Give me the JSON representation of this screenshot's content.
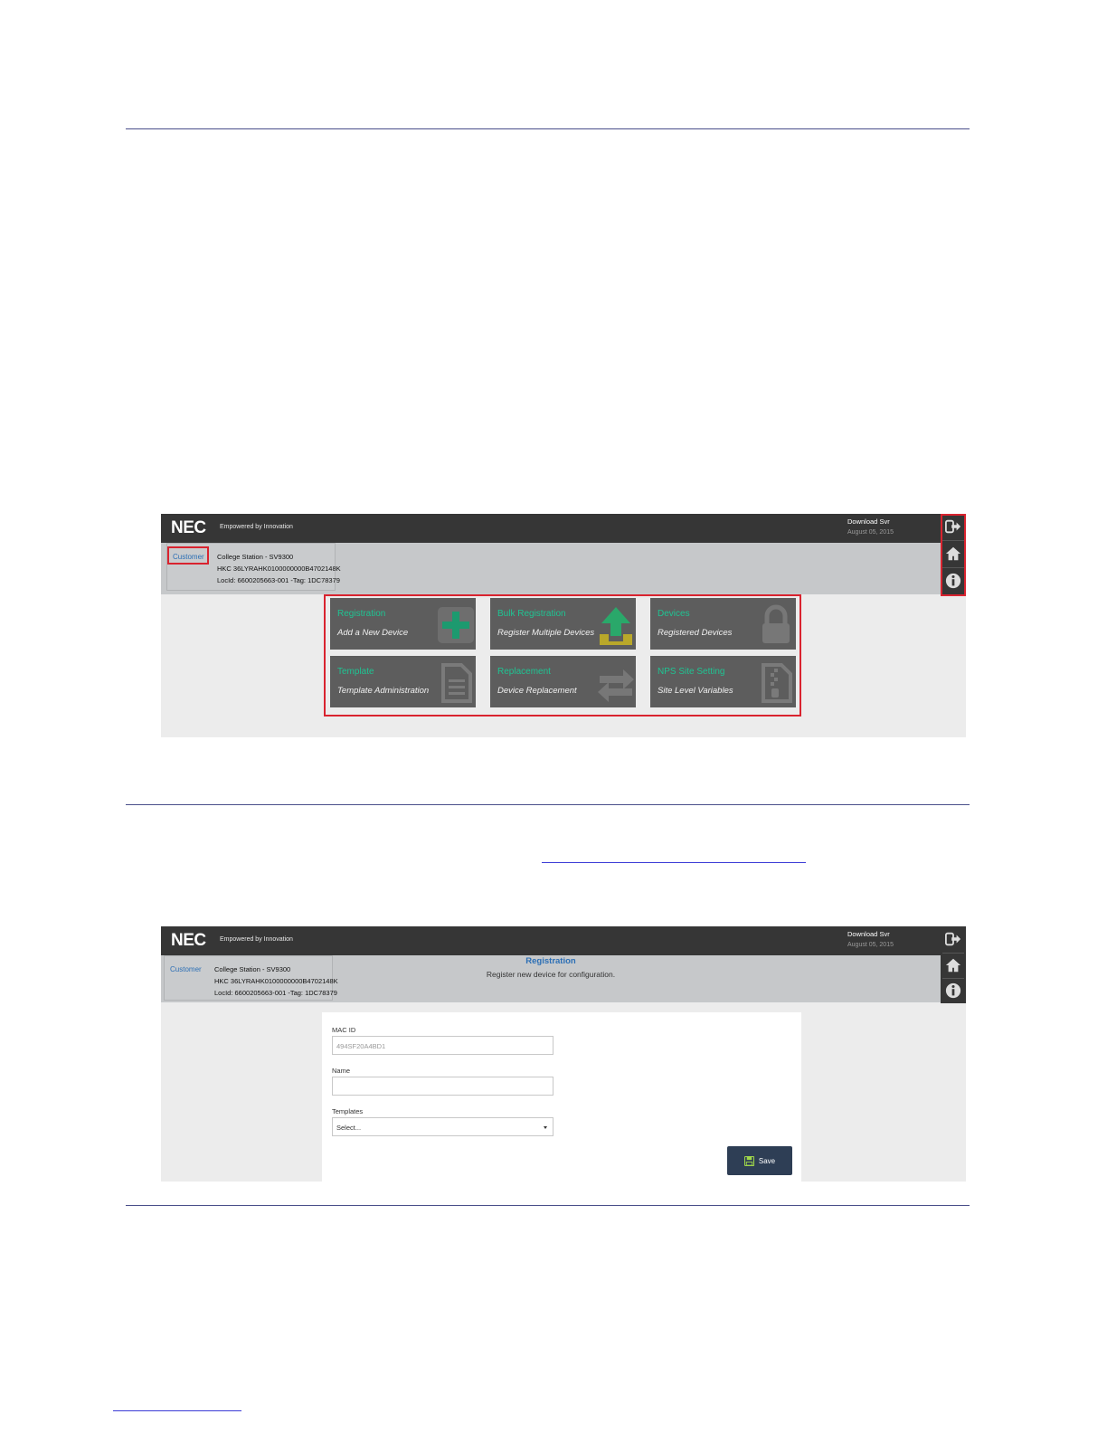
{
  "screen1": {
    "header": {
      "logo": "NEC",
      "tagline": "Empowered by Innovation",
      "download_label": "Download Svr",
      "download_date": "August 05, 2015"
    },
    "customer": {
      "link": "Customer",
      "line1": "College Station - SV9300",
      "line2": "HKC 36LYRAHK0100000000B4702148K",
      "line3": "LocId: 6600205663-001 -Tag: 1DC78379"
    },
    "tiles": [
      {
        "title": "Registration",
        "subtitle": "Add a New Device",
        "icon": "plus-icon"
      },
      {
        "title": "Bulk Registration",
        "subtitle": "Register Multiple Devices",
        "icon": "upload-icon"
      },
      {
        "title": "Devices",
        "subtitle": "Registered Devices",
        "icon": "lock-icon"
      },
      {
        "title": "Template",
        "subtitle": "Template Administration",
        "icon": "document-icon"
      },
      {
        "title": "Replacement",
        "subtitle": "Device Replacement",
        "icon": "swap-arrows-icon"
      },
      {
        "title": "NPS Site Setting",
        "subtitle": "Site Level Variables",
        "icon": "zip-file-icon"
      }
    ],
    "rail_icons": [
      "logout-icon",
      "home-icon",
      "info-icon"
    ]
  },
  "screen2": {
    "header": {
      "logo": "NEC",
      "tagline": "Empowered by Innovation",
      "download_label": "Download Svr",
      "download_date": "August 05, 2015"
    },
    "customer": {
      "link": "Customer",
      "line1": "College Station - SV9300",
      "line2": "HKC 36LYRAHK0100000000B4702148K",
      "line3": "LocId: 6600205663-001 -Tag: 1DC78379"
    },
    "page_title": "Registration",
    "page_subtitle": "Register new device for configuration.",
    "form": {
      "mac_label": "MAC ID",
      "mac_placeholder": "494SF20A4BD1",
      "name_label": "Name",
      "name_value": "",
      "templates_label": "Templates",
      "templates_selected": "Select...",
      "save_label": "Save"
    },
    "rail_icons": [
      "logout-icon",
      "home-icon",
      "info-icon"
    ]
  },
  "colors": {
    "tile_title": "#1fc493",
    "highlight": "#d9232f",
    "link": "#2c6fb5",
    "topbar": "#363636"
  }
}
